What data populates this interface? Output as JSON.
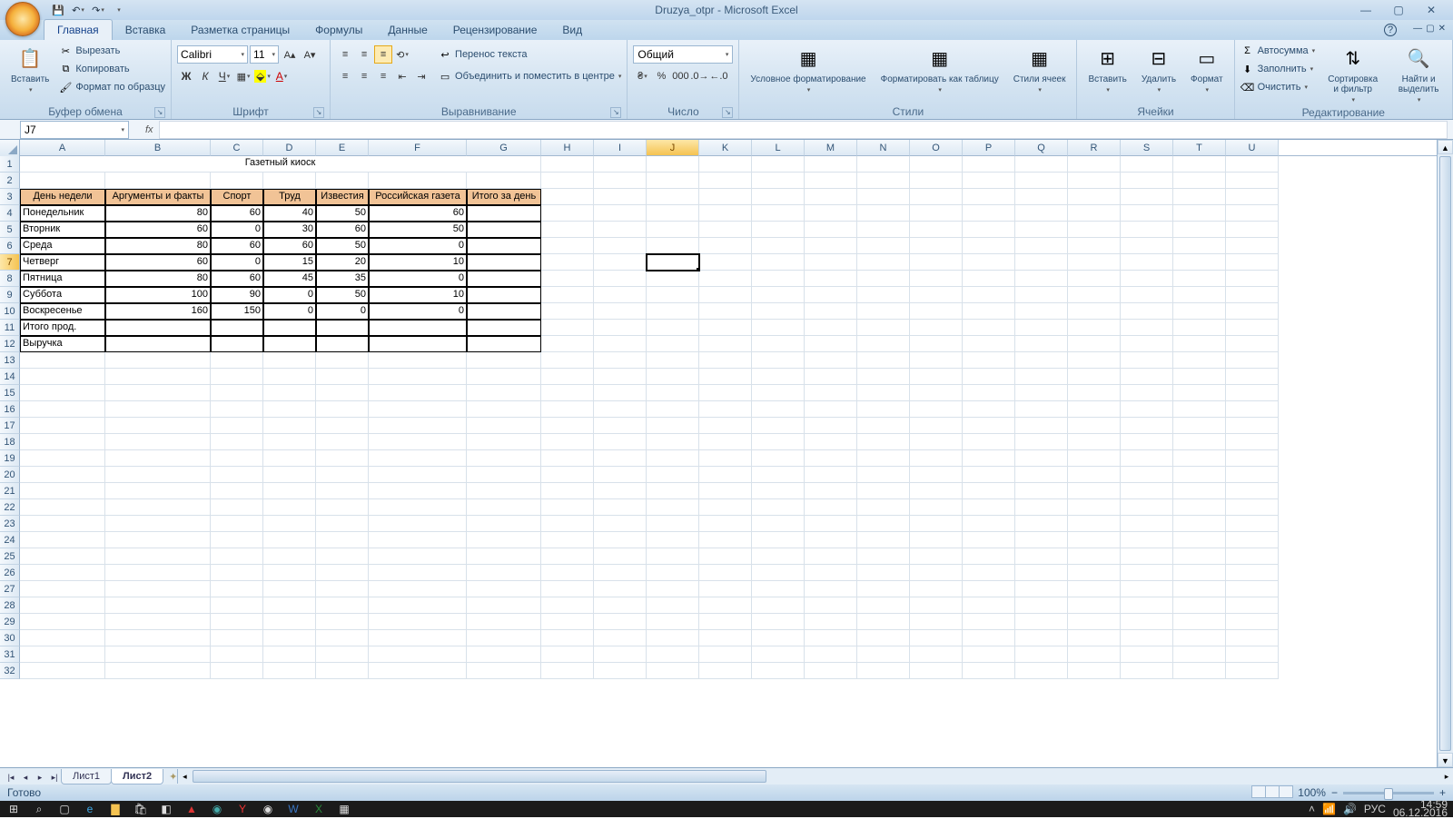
{
  "title": "Druzya_otpr - Microsoft Excel",
  "tabs": [
    "Главная",
    "Вставка",
    "Разметка страницы",
    "Формулы",
    "Данные",
    "Рецензирование",
    "Вид"
  ],
  "active_tab": 0,
  "groups": {
    "clipboard": {
      "label": "Буфер обмена",
      "paste": "Вставить",
      "cut": "Вырезать",
      "copy": "Копировать",
      "format_painter": "Формат по образцу"
    },
    "font": {
      "label": "Шрифт",
      "name": "Calibri",
      "size": "11"
    },
    "align": {
      "label": "Выравнивание",
      "wrap": "Перенос текста",
      "merge": "Объединить и поместить в центре"
    },
    "number": {
      "label": "Число",
      "format": "Общий"
    },
    "styles": {
      "label": "Стили",
      "cond": "Условное форматирование",
      "table": "Форматировать как таблицу",
      "cell": "Стили ячеек"
    },
    "cells": {
      "label": "Ячейки",
      "insert": "Вставить",
      "delete": "Удалить",
      "format": "Формат"
    },
    "editing": {
      "label": "Редактирование",
      "autosum": "Автосумма",
      "fill": "Заполнить",
      "clear": "Очистить",
      "sort": "Сортировка и фильтр",
      "find": "Найти и выделить"
    }
  },
  "namebox": "J7",
  "formula": "",
  "columns": [
    "A",
    "B",
    "C",
    "D",
    "E",
    "F",
    "G",
    "H",
    "I",
    "J",
    "K",
    "L",
    "M",
    "N",
    "O",
    "P",
    "Q",
    "R",
    "S",
    "T",
    "U"
  ],
  "sel_col": "J",
  "row_count": 32,
  "sel_row": 7,
  "col_widths": {
    "A": 94,
    "B": 116,
    "C": 58,
    "D": 58,
    "E": 58,
    "F": 108,
    "G": 82,
    "_default": 58
  },
  "sheet_title": "Газетный киоск",
  "headers": [
    "День недели",
    "Аргументы и факты",
    "Спорт",
    "Труд",
    "Известия",
    "Российская газета",
    "Итого за день"
  ],
  "data_rows": [
    {
      "day": "Понедельник",
      "v": [
        80,
        60,
        40,
        50,
        60,
        ""
      ]
    },
    {
      "day": "Вторник",
      "v": [
        60,
        0,
        30,
        60,
        50,
        ""
      ]
    },
    {
      "day": "Среда",
      "v": [
        80,
        60,
        60,
        50,
        0,
        ""
      ]
    },
    {
      "day": "Четверг",
      "v": [
        60,
        0,
        15,
        20,
        10,
        ""
      ]
    },
    {
      "day": "Пятница",
      "v": [
        80,
        60,
        45,
        35,
        0,
        ""
      ]
    },
    {
      "day": "Суббота",
      "v": [
        100,
        90,
        0,
        50,
        10,
        ""
      ]
    },
    {
      "day": "Воскресенье",
      "v": [
        160,
        150,
        0,
        0,
        0,
        ""
      ]
    },
    {
      "day": "Итого прод.",
      "v": [
        "",
        "",
        "",
        "",
        "",
        ""
      ]
    },
    {
      "day": "Выручка",
      "v": [
        "",
        "",
        "",
        "",
        "",
        ""
      ]
    }
  ],
  "sheet_tabs": [
    "Лист1",
    "Лист2"
  ],
  "active_sheet": 1,
  "status": "Готово",
  "zoom": "100%",
  "lang": "РУС",
  "time": "14:59",
  "date": "06.12.2016"
}
